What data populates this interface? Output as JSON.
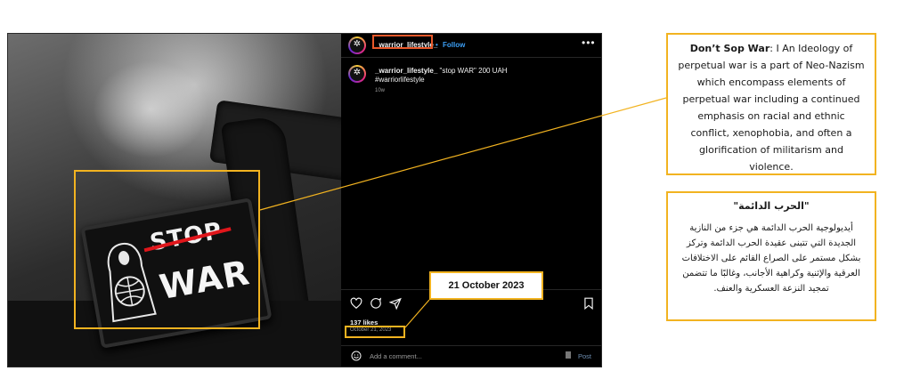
{
  "post": {
    "username": "_warrior_lifestyle_",
    "bullet": "•",
    "follow_label": "Follow",
    "more_icon": "more-horizontal-icon",
    "caption_user": "_warrior_lifestyle_",
    "caption_text": "\"stop WAR\" 200 UAH",
    "caption_tag": "#warriorlifestyle",
    "age": "10w",
    "likes": "137 likes",
    "date": "October 21, 2023",
    "comment_placeholder": "Add a comment...",
    "post_label": "Post",
    "avatar_glyph": "✲",
    "patch_top": "STOP",
    "patch_bottom": "WAR"
  },
  "annotations": {
    "date_callout": "21 October 2023",
    "english_title": "Don’t Sop War",
    "english_body": ": I  An Ideology of perpetual war is a part of Neo-Nazism which encompass elements of perpetual war including a continued emphasis on racial and ethnic conflict, xenophobia, and often a glorification of militarism and violence.",
    "arabic_title": "\"الحرب الدائمة\"",
    "arabic_body": "أيديولوجية الحرب الدائمة هي جزء من النازية الجديدة التي تتبنى عقيدة الحرب الدائمة وتركز بشكل مستمر على الصراع القائم على الاختلافات العرقية والإثنية وكراهية الأجانب، وغالبًا ما تتضمن تمجيد النزعة العسكرية والعنف.",
    "highlight_color": "#f2b320"
  }
}
